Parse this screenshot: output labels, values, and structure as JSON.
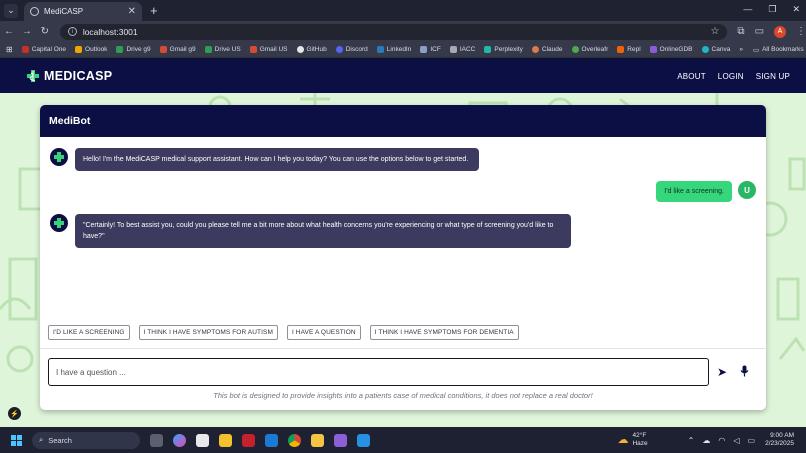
{
  "browser": {
    "tab_title": "MediCASP",
    "url": "localhost:3001",
    "profile_initial": "A",
    "bookmarks": [
      "Capital One",
      "Outlook",
      "Drive g9",
      "Gmail g9",
      "Drive US",
      "Gmail US",
      "GitHub",
      "Discord",
      "LinkedIn",
      "ICF",
      "IACC",
      "Perplexity",
      "Claude",
      "Overleafr",
      "Repl",
      "OnlineGDB",
      "Canva"
    ],
    "all_bookmarks_label": "All Bookmarks"
  },
  "app": {
    "logo_text": "MEDICASP",
    "nav": [
      "ABOUT",
      "LOGIN",
      "SIGN UP"
    ],
    "chat_title": "MediBot",
    "messages": [
      {
        "from": "bot",
        "text": "Hello! I'm the MediCASP medical support assistant. How can I help you today? You can use the options below to get started."
      },
      {
        "from": "user",
        "text": "I'd like a screening.",
        "avatar": "U"
      },
      {
        "from": "bot",
        "text": "\"Certainly! To best assist you, could you please tell me a bit more about what health concerns you're experiencing or what type of screening you'd like to have?\""
      }
    ],
    "quick_replies": [
      "I'D LIKE A SCREENING",
      "I THINK I HAVE SYMPTOMS FOR AUTISM",
      "I HAVE A QUESTION",
      "I THINK I HAVE SYMPTOMS FOR DEMENTIA"
    ],
    "input_value": "I have a question ...",
    "disclaimer": "This bot is designed to provide insights into a patients case of medical conditions, it does not replace a real doctor!"
  },
  "taskbar": {
    "search_placeholder": "Search",
    "weather_temp": "42°F",
    "weather_desc": "Haze",
    "time": "9:00 AM",
    "date": "2/23/2025"
  },
  "colors": {
    "navy": "#0c0f43",
    "bot_bubble": "#3c3a5e",
    "user_bubble": "#35d67c",
    "app_background": "#dff5d9"
  }
}
